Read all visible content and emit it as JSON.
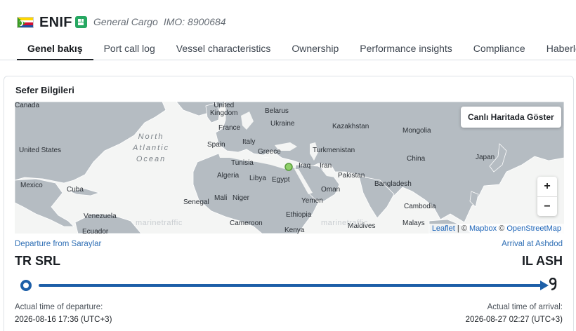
{
  "header": {
    "flag_icon": "comoros-flag-icon",
    "vessel_name": "ENIF",
    "vessel_type": "General Cargo",
    "imo": "IMO: 8900684"
  },
  "tabs": [
    {
      "label": "Genel bakış",
      "active": true
    },
    {
      "label": "Port call log"
    },
    {
      "label": "Vessel characteristics"
    },
    {
      "label": "Ownership"
    },
    {
      "label": "Performance insights"
    },
    {
      "label": "Compliance"
    },
    {
      "label": "Haberlerde"
    }
  ],
  "voyage": {
    "title": "Sefer Bilgileri",
    "map": {
      "live_button": "Canlı Haritada Göster",
      "zoom_in": "+",
      "zoom_out": "−",
      "watermark": "marinetraffic",
      "attribution": {
        "leaflet": "Leaflet",
        "sep1": " | © ",
        "mapbox": "Mapbox",
        "sep2": " © ",
        "osm": "OpenStreetMap"
      },
      "ocean_label": [
        "North",
        "Atlantic",
        "Ocean"
      ],
      "labels": {
        "canada": "Canada",
        "united_kingdom": [
          "United",
          "Kingdom"
        ],
        "belarus": "Belarus",
        "ukraine": "Ukraine",
        "france": "France",
        "kazakhstan": "Kazakhstan",
        "mongolia": "Mongolia",
        "united_states": "United States",
        "spain": "Spain",
        "italy": "Italy",
        "greece": "Greece",
        "turkmenistan": "Turkmenistan",
        "china": "China",
        "japan": "Japan",
        "tunisia": "Tunisia",
        "iraq": "Iraq",
        "iran": "Iran",
        "algeria": "Algeria",
        "libya": "Libya",
        "egypt": "Egypt",
        "pakistan": "Pakistan",
        "mexico": "Mexico",
        "cuba": "Cuba",
        "bangladesh": "Bangladesh",
        "oman": "Oman",
        "senegal": "Senegal",
        "mali": "Mali",
        "niger": "Niger",
        "yemen": "Yemen",
        "cambodia": "Cambodia",
        "venezuela": "Venezuela",
        "ethiopia": "Ethiopia",
        "cameroon": "Cameroon",
        "maldives": "Maldives",
        "malaysia": "Malays",
        "kenya": "Kenya",
        "ecuador": "Ecuador"
      }
    },
    "departure": {
      "label": "Departure from Saraylar",
      "code": "TR SRL",
      "time_label": "Actual time of departure:",
      "time": "2026-08-16 17:36 (UTC+3)"
    },
    "arrival": {
      "label": "Arrival at Ashdod",
      "code": "IL ASH",
      "time_label": "Actual time of arrival:",
      "time": "2026-08-27 02:27 (UTC+3)"
    },
    "progress_fraction": 1.0
  },
  "colors": {
    "accent": "#1d5fa8",
    "link": "#2f6fb5",
    "land": "#b5bcc2",
    "vessel_marker": "#8fd06a"
  }
}
